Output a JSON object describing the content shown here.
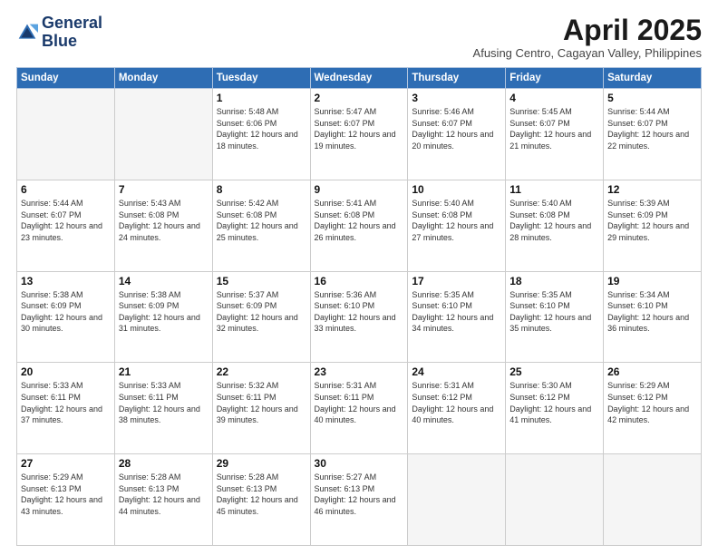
{
  "logo": {
    "line1": "General",
    "line2": "Blue"
  },
  "header": {
    "month": "April 2025",
    "location": "Afusing Centro, Cagayan Valley, Philippines"
  },
  "weekdays": [
    "Sunday",
    "Monday",
    "Tuesday",
    "Wednesday",
    "Thursday",
    "Friday",
    "Saturday"
  ],
  "weeks": [
    [
      {
        "day": "",
        "info": ""
      },
      {
        "day": "",
        "info": ""
      },
      {
        "day": "1",
        "info": "Sunrise: 5:48 AM\nSunset: 6:06 PM\nDaylight: 12 hours and 18 minutes."
      },
      {
        "day": "2",
        "info": "Sunrise: 5:47 AM\nSunset: 6:07 PM\nDaylight: 12 hours and 19 minutes."
      },
      {
        "day": "3",
        "info": "Sunrise: 5:46 AM\nSunset: 6:07 PM\nDaylight: 12 hours and 20 minutes."
      },
      {
        "day": "4",
        "info": "Sunrise: 5:45 AM\nSunset: 6:07 PM\nDaylight: 12 hours and 21 minutes."
      },
      {
        "day": "5",
        "info": "Sunrise: 5:44 AM\nSunset: 6:07 PM\nDaylight: 12 hours and 22 minutes."
      }
    ],
    [
      {
        "day": "6",
        "info": "Sunrise: 5:44 AM\nSunset: 6:07 PM\nDaylight: 12 hours and 23 minutes."
      },
      {
        "day": "7",
        "info": "Sunrise: 5:43 AM\nSunset: 6:08 PM\nDaylight: 12 hours and 24 minutes."
      },
      {
        "day": "8",
        "info": "Sunrise: 5:42 AM\nSunset: 6:08 PM\nDaylight: 12 hours and 25 minutes."
      },
      {
        "day": "9",
        "info": "Sunrise: 5:41 AM\nSunset: 6:08 PM\nDaylight: 12 hours and 26 minutes."
      },
      {
        "day": "10",
        "info": "Sunrise: 5:40 AM\nSunset: 6:08 PM\nDaylight: 12 hours and 27 minutes."
      },
      {
        "day": "11",
        "info": "Sunrise: 5:40 AM\nSunset: 6:08 PM\nDaylight: 12 hours and 28 minutes."
      },
      {
        "day": "12",
        "info": "Sunrise: 5:39 AM\nSunset: 6:09 PM\nDaylight: 12 hours and 29 minutes."
      }
    ],
    [
      {
        "day": "13",
        "info": "Sunrise: 5:38 AM\nSunset: 6:09 PM\nDaylight: 12 hours and 30 minutes."
      },
      {
        "day": "14",
        "info": "Sunrise: 5:38 AM\nSunset: 6:09 PM\nDaylight: 12 hours and 31 minutes."
      },
      {
        "day": "15",
        "info": "Sunrise: 5:37 AM\nSunset: 6:09 PM\nDaylight: 12 hours and 32 minutes."
      },
      {
        "day": "16",
        "info": "Sunrise: 5:36 AM\nSunset: 6:10 PM\nDaylight: 12 hours and 33 minutes."
      },
      {
        "day": "17",
        "info": "Sunrise: 5:35 AM\nSunset: 6:10 PM\nDaylight: 12 hours and 34 minutes."
      },
      {
        "day": "18",
        "info": "Sunrise: 5:35 AM\nSunset: 6:10 PM\nDaylight: 12 hours and 35 minutes."
      },
      {
        "day": "19",
        "info": "Sunrise: 5:34 AM\nSunset: 6:10 PM\nDaylight: 12 hours and 36 minutes."
      }
    ],
    [
      {
        "day": "20",
        "info": "Sunrise: 5:33 AM\nSunset: 6:11 PM\nDaylight: 12 hours and 37 minutes."
      },
      {
        "day": "21",
        "info": "Sunrise: 5:33 AM\nSunset: 6:11 PM\nDaylight: 12 hours and 38 minutes."
      },
      {
        "day": "22",
        "info": "Sunrise: 5:32 AM\nSunset: 6:11 PM\nDaylight: 12 hours and 39 minutes."
      },
      {
        "day": "23",
        "info": "Sunrise: 5:31 AM\nSunset: 6:11 PM\nDaylight: 12 hours and 40 minutes."
      },
      {
        "day": "24",
        "info": "Sunrise: 5:31 AM\nSunset: 6:12 PM\nDaylight: 12 hours and 40 minutes."
      },
      {
        "day": "25",
        "info": "Sunrise: 5:30 AM\nSunset: 6:12 PM\nDaylight: 12 hours and 41 minutes."
      },
      {
        "day": "26",
        "info": "Sunrise: 5:29 AM\nSunset: 6:12 PM\nDaylight: 12 hours and 42 minutes."
      }
    ],
    [
      {
        "day": "27",
        "info": "Sunrise: 5:29 AM\nSunset: 6:13 PM\nDaylight: 12 hours and 43 minutes."
      },
      {
        "day": "28",
        "info": "Sunrise: 5:28 AM\nSunset: 6:13 PM\nDaylight: 12 hours and 44 minutes."
      },
      {
        "day": "29",
        "info": "Sunrise: 5:28 AM\nSunset: 6:13 PM\nDaylight: 12 hours and 45 minutes."
      },
      {
        "day": "30",
        "info": "Sunrise: 5:27 AM\nSunset: 6:13 PM\nDaylight: 12 hours and 46 minutes."
      },
      {
        "day": "",
        "info": ""
      },
      {
        "day": "",
        "info": ""
      },
      {
        "day": "",
        "info": ""
      }
    ]
  ]
}
